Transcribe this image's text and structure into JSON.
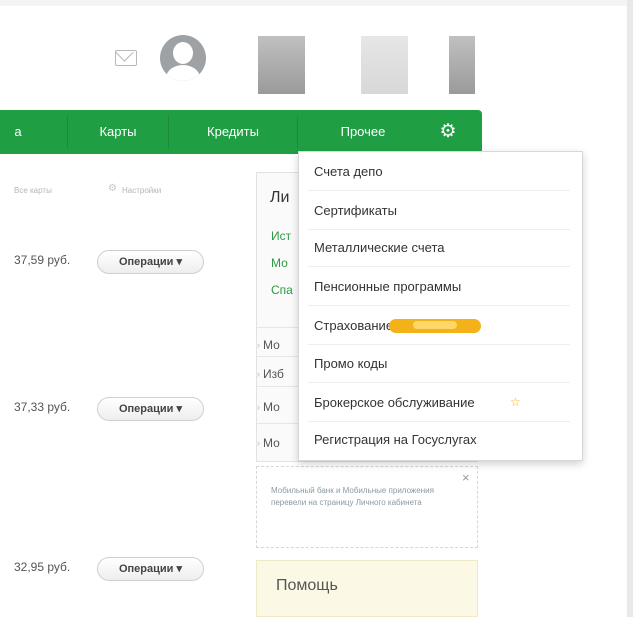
{
  "header": {
    "mail_icon": "envelope-icon",
    "avatar_icon": "user-avatar-icon"
  },
  "nav": {
    "partial_label": "а",
    "items": [
      "Карты",
      "Кредиты",
      "Прочее"
    ],
    "settings_icon": "gear-icon",
    "color": "#1f9e44"
  },
  "toolbar": {
    "partial_link": "Все карты",
    "settings_label": "Настройки"
  },
  "accounts": [
    {
      "amount": "37,59 руб.",
      "button": "Операции"
    },
    {
      "amount": "37,33 руб.",
      "button": "Операции"
    },
    {
      "amount": "32,95 руб.",
      "button": "Операции"
    }
  ],
  "side_panel": {
    "title": "Ли",
    "links": [
      "Ист",
      "Мо",
      "Спа"
    ],
    "rows": [
      "Мо",
      "Изб",
      "Мо",
      "Мо"
    ]
  },
  "dropdown": {
    "items": [
      "Счета депо",
      "Сертификаты",
      "Металлические счета",
      "Пенсионные программы",
      "Страхование",
      "Промо коды",
      "Брокерское обслуживание",
      "Регистрация на Госуслугах"
    ],
    "badge_color": "#f3b21a"
  },
  "tip": {
    "text": "Мобильный банк и Мобильные приложения перевели на страницу Личного кабинета",
    "close": "×"
  },
  "help": {
    "title": "Помощь"
  }
}
